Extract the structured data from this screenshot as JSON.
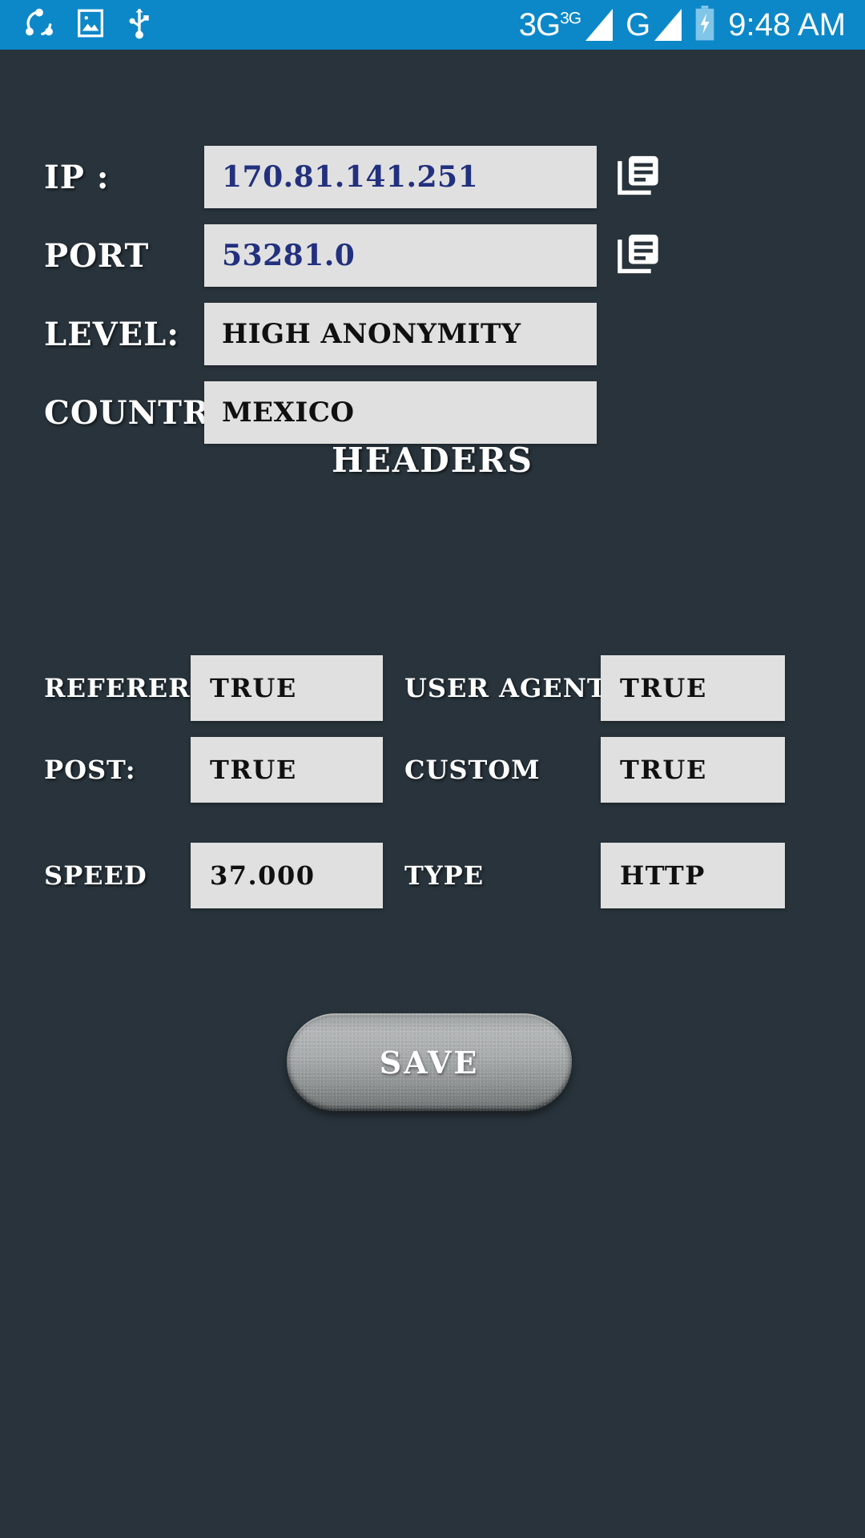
{
  "statusbar": {
    "background": "#0c88c8",
    "icons": [
      "share-icon",
      "gallery-icon",
      "usb-icon"
    ],
    "network_primary": "3G",
    "network_primary_sup": "3G",
    "network_secondary": "G",
    "battery": "battery-charging-icon",
    "time": "9:48 AM"
  },
  "theme": {
    "background": "#28333b",
    "field_background": "#e0e0e0",
    "value_blue": "#22307e",
    "value_black": "#101010",
    "label_white": "#ffffff"
  },
  "details": {
    "ip": {
      "label": "IP :",
      "value": "170.81.141.251",
      "copy_icon": "copy-icon"
    },
    "port": {
      "label": "PORT",
      "value": "53281.0",
      "copy_icon": "copy-icon"
    },
    "level": {
      "label": "LEVEL:",
      "value": "HIGH ANONYMITY"
    },
    "country": {
      "label": "COUNTRY:",
      "value": "MEXICO"
    }
  },
  "headers": {
    "title": "HEADERS",
    "rows": [
      {
        "left_label": "REFERER",
        "left_value": "TRUE",
        "right_label": "USER AGENT",
        "right_value": "TRUE"
      },
      {
        "left_label": "POST:",
        "left_value": "TRUE",
        "right_label": "CUSTOM",
        "right_value": "TRUE"
      },
      {
        "left_label": "SPEED",
        "left_value": "37.000",
        "right_label": "TYPE",
        "right_value": "HTTP"
      }
    ]
  },
  "actions": {
    "save_label": "SAVE"
  }
}
